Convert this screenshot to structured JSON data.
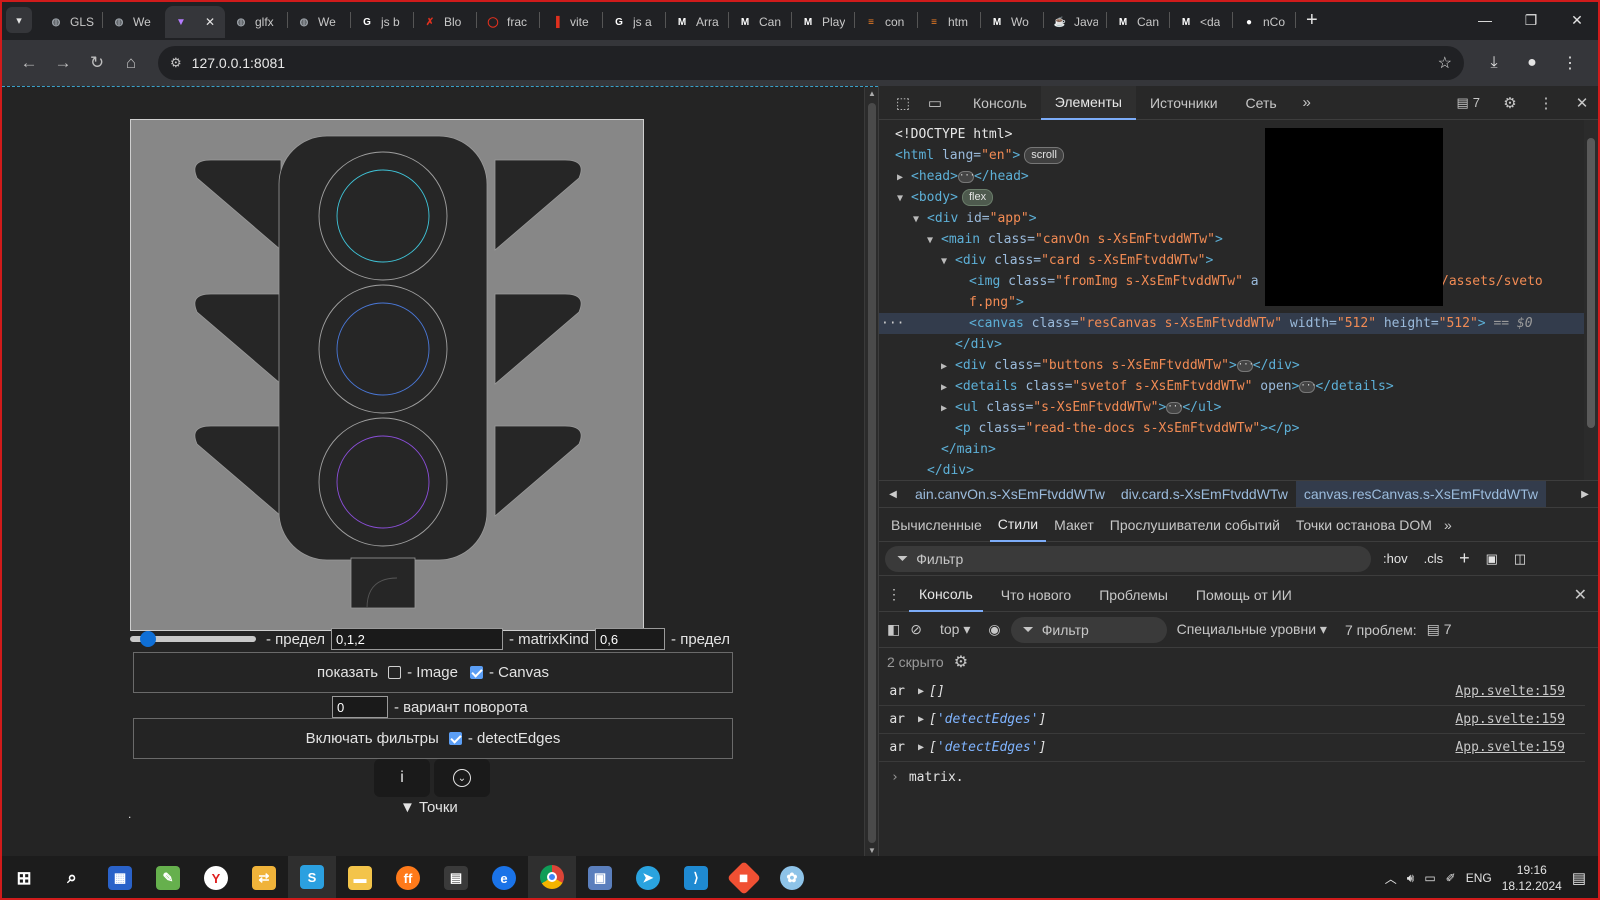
{
  "browser": {
    "tabs": [
      {
        "label": "GLS",
        "icon": "globe-icon",
        "color": "#9aa0a6"
      },
      {
        "label": "We",
        "icon": "globe-icon",
        "color": "#9aa0a6"
      },
      {
        "label": "",
        "icon": "vite-icon",
        "color": "#b57cff",
        "active": true
      },
      {
        "label": "glfx",
        "icon": "globe-icon",
        "color": "#9aa0a6"
      },
      {
        "label": "We",
        "icon": "globe-icon",
        "color": "#9aa0a6"
      },
      {
        "label": "js b",
        "icon": "google-icon",
        "color": "#ffffff"
      },
      {
        "label": "Blo",
        "icon": "blog-icon",
        "color": "#e0301e"
      },
      {
        "label": "frac",
        "icon": "ring-icon",
        "color": "#e0301e"
      },
      {
        "label": "vite",
        "icon": "vite-red-icon",
        "color": "#e0301e"
      },
      {
        "label": "js a",
        "icon": "google-icon",
        "color": "#ffffff"
      },
      {
        "label": "Arra",
        "icon": "mdn-icon",
        "color": "#ffffff"
      },
      {
        "label": "Can",
        "icon": "mdn-icon",
        "color": "#ffffff"
      },
      {
        "label": "Play",
        "icon": "mdn-icon",
        "color": "#ffffff"
      },
      {
        "label": "con",
        "icon": "so-icon",
        "color": "#f48024"
      },
      {
        "label": "htm",
        "icon": "so-icon",
        "color": "#f48024"
      },
      {
        "label": "Wo",
        "icon": "mdn-icon",
        "color": "#ffffff"
      },
      {
        "label": "Java",
        "icon": "java-icon",
        "color": "#ffffff"
      },
      {
        "label": "Can",
        "icon": "mdn-icon",
        "color": "#ffffff"
      },
      {
        "label": "<da",
        "icon": "mdn-icon",
        "color": "#ffffff"
      },
      {
        "label": "nCo",
        "icon": "github-icon",
        "color": "#ffffff"
      }
    ],
    "url": "127.0.0.1:8081"
  },
  "page": {
    "slider": {
      "value": 0.1
    },
    "label_limit1": "- предел",
    "input_filter": "0,1,2",
    "label_matrixkind": "- matrixKind",
    "input_matrix": "0,6",
    "label_limit2": "- предел",
    "show_label": "показать",
    "image_label": "- Image",
    "canvas_label": "- Canvas",
    "rotate_value": "0",
    "rotate_label": "- вариант поворота",
    "filters_label": "Включать фильтры",
    "detect_label": "- detectEdges",
    "info_btn": "i",
    "details_label": "▼ Точки",
    "stray_dot": "."
  },
  "devtools": {
    "tabs": [
      "Консоль",
      "Элементы",
      "Источники",
      "Сеть"
    ],
    "active_tab": "Элементы",
    "badge_count": "7",
    "dom": {
      "doctype": "<!DOCTYPE html>",
      "html_open": "<html",
      "html_lang_attr": " lang=",
      "html_lang_val": "\"en\"",
      "scroll_pill": "scroll",
      "head_open": "<head>",
      "head_close": "</head>",
      "body_open": "<body>",
      "flex_pill": "flex",
      "div_app": "<div",
      "id_attr": " id=",
      "app_val": "\"app\"",
      "main_tag": "<main",
      "class_attr": " class=",
      "main_class": "\"canvOn s-XsEmFtvddWTw\"",
      "div_card": "<div",
      "card_class": "\"card s-XsEmFtvddWTw\"",
      "img_tag": "<img",
      "img_class": "\"fromImg s-XsEmFtvddWTw\"",
      "img_a": " a",
      "img_src_tail": "/assets/sveto",
      "img_src_tail2": "f.png\"",
      "canvas_tag": "<canvas",
      "canvas_class": "\"resCanvas s-XsEmFtvddWTw\"",
      "width_attr": " width=",
      "width_val": "\"512\"",
      "height_attr": " height=",
      "height_val": "\"512\"",
      "eq_dollar": " == $0",
      "div_close": "</div>",
      "buttons_tag": "<div",
      "buttons_class": "\"buttons s-XsEmFtvddWTw\"",
      "details_tag": "<details",
      "details_class": "\"svetof s-XsEmFtvddWTw\"",
      "open_attr": " open",
      "details_close": "</details>",
      "ul_tag": "<ul",
      "ul_class": "\"s-XsEmFtvddWTw\"",
      "ul_close": "</ul>",
      "p_tag": "<p",
      "p_class": "\"read-the-docs s-XsEmFtvddWTw\"",
      "p_close": "></p>",
      "main_close": "</main>",
      "gt": ">"
    },
    "breadcrumbs": [
      "ain.canvOn.s-XsEmFtvddWTw",
      "div.card.s-XsEmFtvddWTw",
      "canvas.resCanvas.s-XsEmFtvddWTw"
    ],
    "subtabs": [
      "Вычисленные",
      "Стили",
      "Макет",
      "Прослушиватели событий",
      "Точки останова DOM"
    ],
    "active_subtab": "Стили",
    "styles_filter_placeholder": "Фильтр",
    "hov": ":hov",
    "cls": ".cls",
    "drawer_tabs": [
      "Консоль",
      "Что нового",
      "Проблемы",
      "Помощь от ИИ"
    ],
    "active_drawer_tab": "Консоль",
    "console": {
      "context": "top",
      "filter_placeholder": "Фильтр",
      "levels": "Специальные уровни",
      "issues": "7 проблем:",
      "issues_count": "7",
      "hidden": "2 скрыто",
      "logs": [
        {
          "label": "ar",
          "open": "[",
          "item": "",
          "close": "]",
          "source": "App.svelte:159"
        },
        {
          "label": "ar",
          "open": "[",
          "item": "'detectEdges'",
          "close": "]",
          "source": "App.svelte:159"
        },
        {
          "label": "ar",
          "open": "[",
          "item": "'detectEdges'",
          "close": "]",
          "source": "App.svelte:159"
        }
      ],
      "prompt_text": "matrix."
    }
  },
  "taskbar": {
    "lang": "ENG",
    "time": "19:16",
    "date": "18.12.2024"
  }
}
